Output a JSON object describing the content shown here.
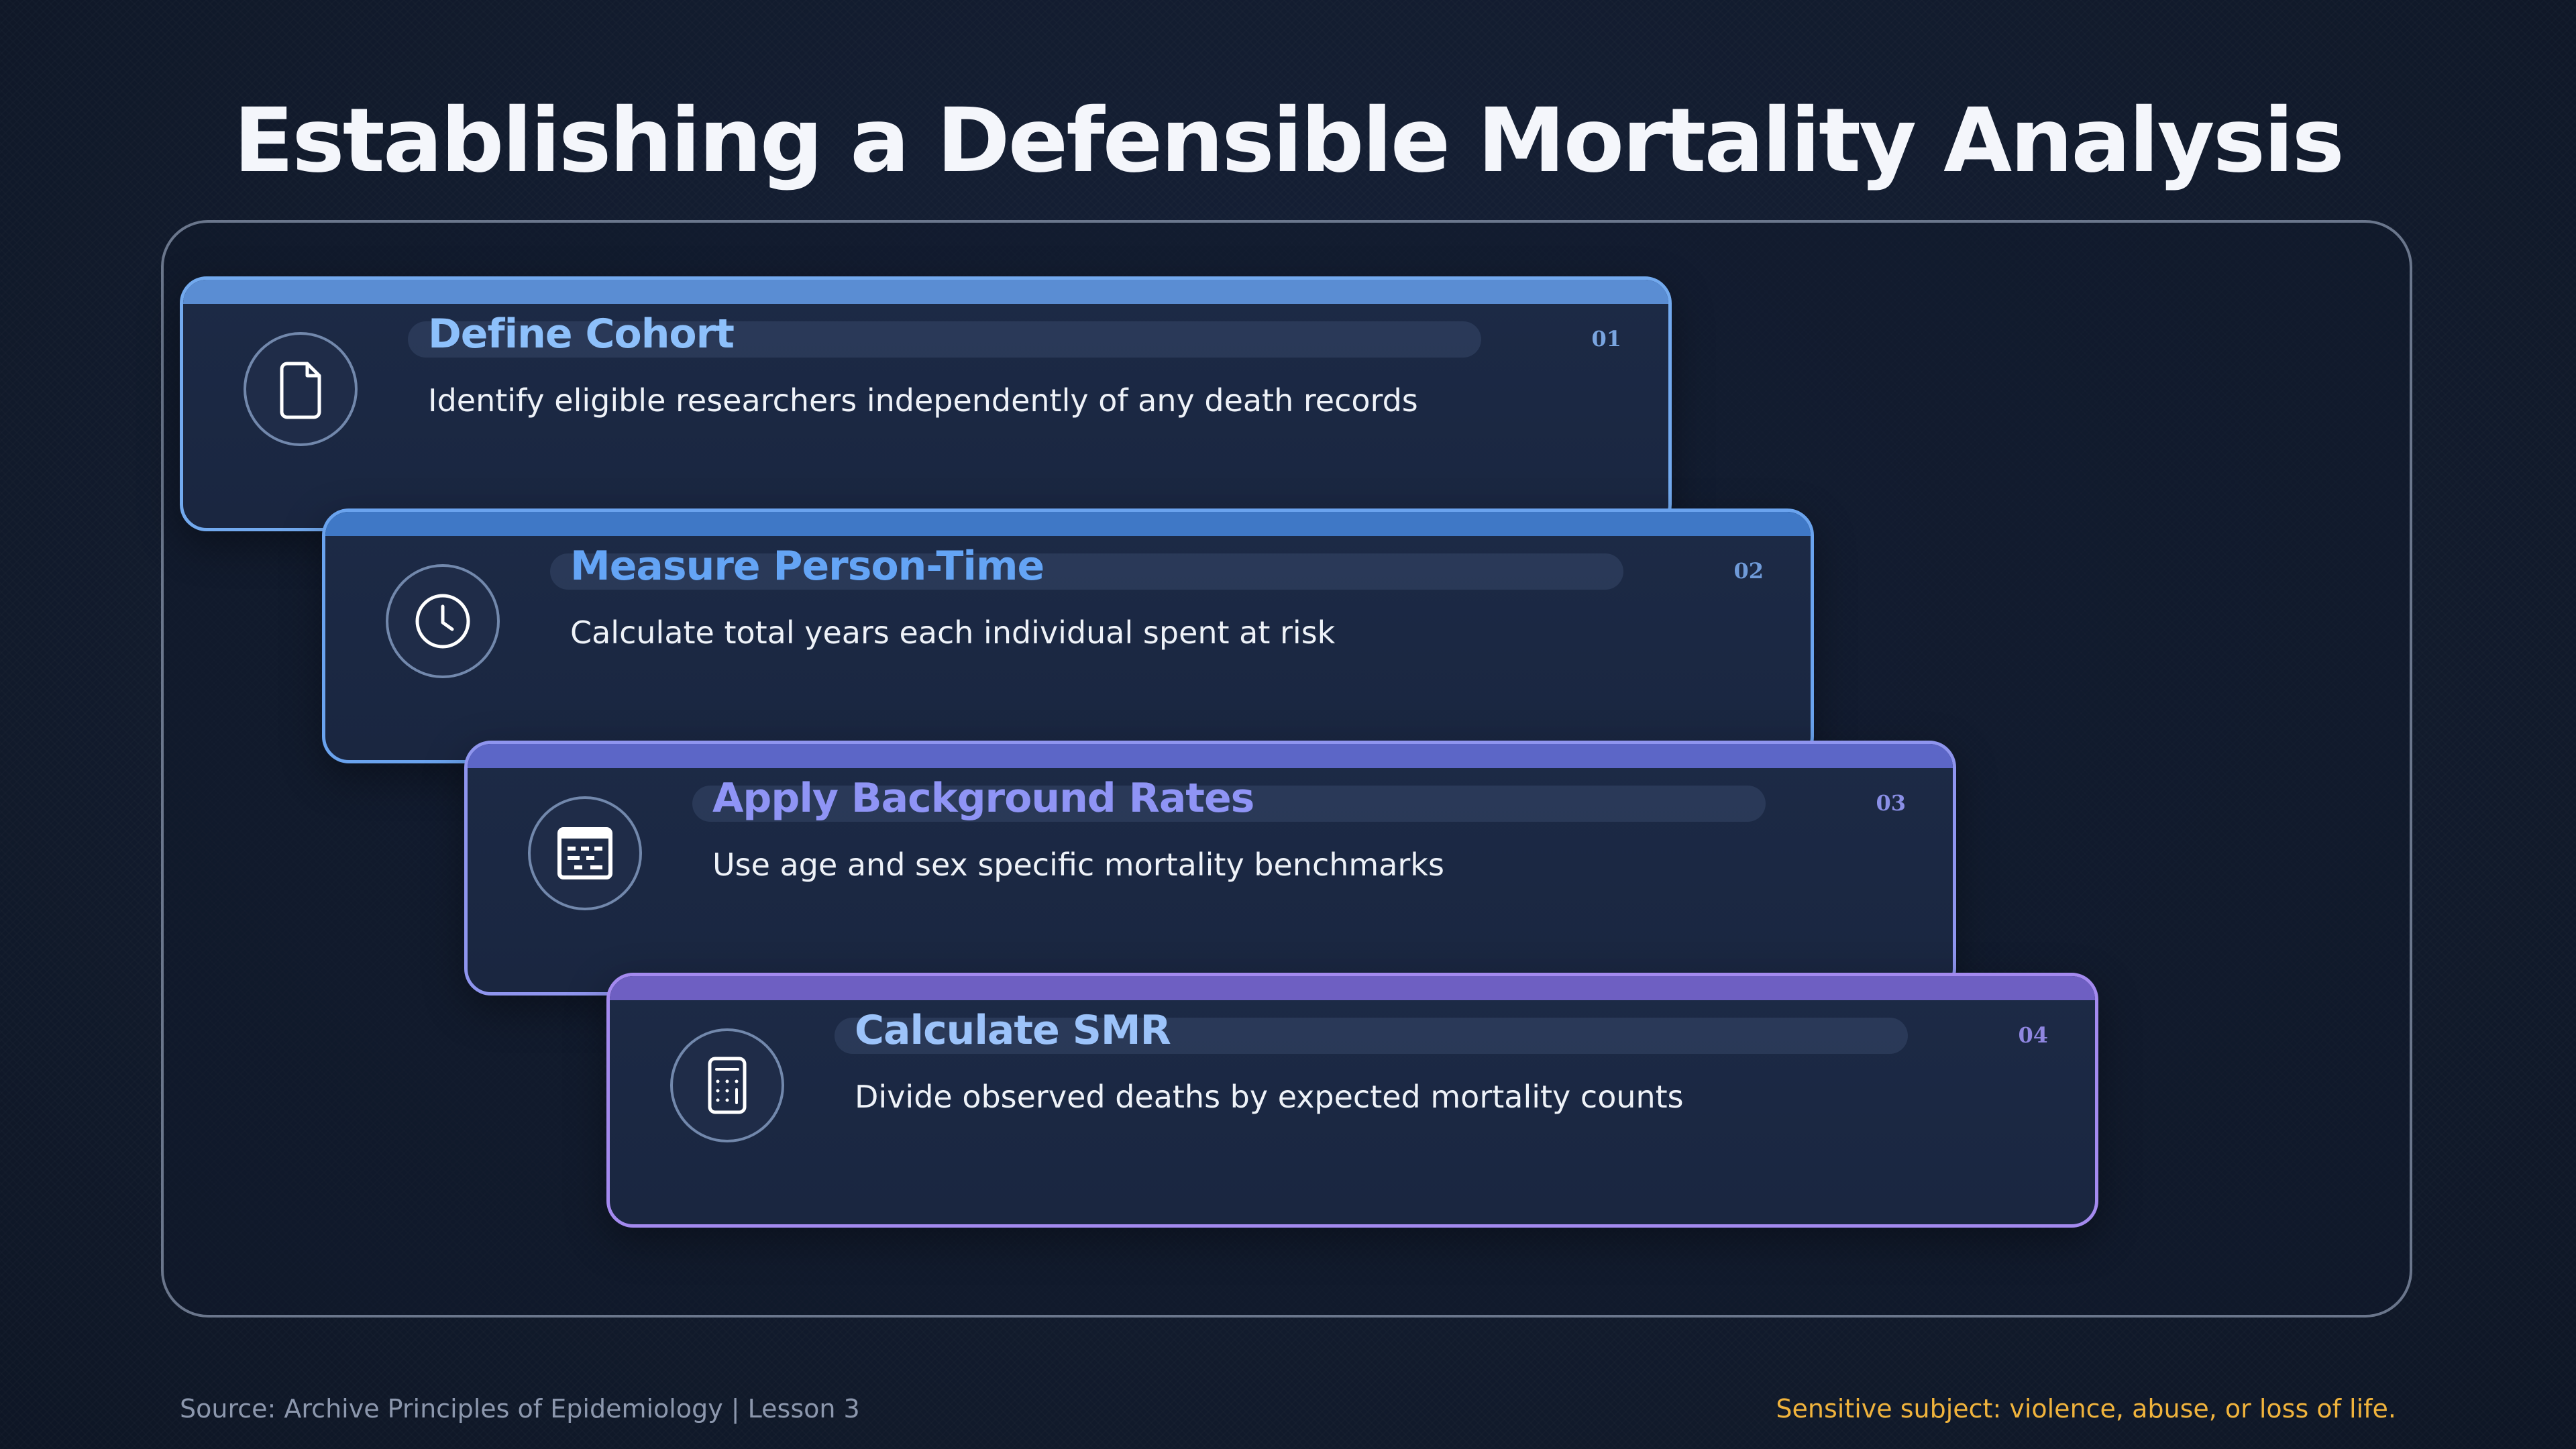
{
  "slide": {
    "title": "Establishing a Defensible Mortality Analysis"
  },
  "steps": [
    {
      "number": "01",
      "title": "Define Cohort",
      "description": "Identify eligible researchers independently of any death records",
      "icon": "document-icon"
    },
    {
      "number": "02",
      "title": "Measure Person-Time",
      "description": "Calculate total years each individual spent at risk",
      "icon": "clock-icon"
    },
    {
      "number": "03",
      "title": "Apply Background Rates",
      "description": "Use age and sex specific mortality benchmarks",
      "icon": "table-icon"
    },
    {
      "number": "04",
      "title": "Calculate SMR",
      "description": "Divide observed deaths by expected mortality counts",
      "icon": "calculator-icon"
    }
  ],
  "footer": {
    "source": "Source: Archive Principles of Epidemiology | Lesson 3",
    "warning": "Sensitive subject: violence, abuse, or loss of life."
  },
  "colors": {
    "background": "#121b2d",
    "title": "#f4f6fb",
    "warning": "#f0b33c",
    "step_1_accent": "#72a9ee",
    "step_2_accent": "#6aa3ee",
    "step_3_accent": "#8f95ef",
    "step_4_accent": "#a48aef"
  }
}
